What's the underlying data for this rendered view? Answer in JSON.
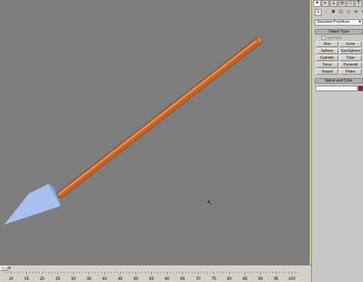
{
  "command_panel": {
    "tabs": [
      {
        "name": "create-tab-icon",
        "glyph": "✦",
        "active": true
      },
      {
        "name": "modify-tab-icon",
        "glyph": "◐",
        "active": false
      },
      {
        "name": "hierarchy-tab-icon",
        "glyph": "⊥",
        "active": false
      },
      {
        "name": "motion-tab-icon",
        "glyph": "◎",
        "active": false
      },
      {
        "name": "display-tab-icon",
        "glyph": "□",
        "active": false
      },
      {
        "name": "utilities-tab-icon",
        "glyph": "T",
        "active": false
      }
    ],
    "subtabs": [
      {
        "name": "geometry-icon",
        "glyph": "●",
        "active": true
      },
      {
        "name": "shapes-icon",
        "glyph": "◌",
        "active": false
      },
      {
        "name": "lights-icon",
        "glyph": "✱",
        "active": false
      },
      {
        "name": "cameras-icon",
        "glyph": "⊡",
        "active": false
      },
      {
        "name": "helpers-icon",
        "glyph": "◇",
        "active": false
      },
      {
        "name": "spacewarps-icon",
        "glyph": "≋",
        "active": false
      },
      {
        "name": "systems-icon",
        "glyph": "⚙",
        "active": false
      }
    ],
    "category_select": "Standard Primitives",
    "object_type": {
      "sign": "-",
      "title": "Object Type",
      "autogrid": "AutoGrid",
      "buttons": [
        "Box",
        "Cone",
        "Sphere",
        "GeoSphere",
        "Cylinder",
        "Tube",
        "Torus",
        "Pyramid",
        "Teapot",
        "Plane"
      ]
    },
    "name_and_color": {
      "sign": "-",
      "title": "Name and Color",
      "name_value": "",
      "color": "#a01040"
    }
  },
  "viewport": {
    "background": "#7d7d7d",
    "shaft_color": "#c8621e",
    "head_color": "#a8c0f0"
  },
  "timeline": {
    "ticks": [
      10,
      15,
      20,
      25,
      30,
      35,
      40,
      45,
      50,
      55,
      60,
      65,
      70,
      75,
      80,
      85,
      90,
      95,
      100
    ]
  }
}
